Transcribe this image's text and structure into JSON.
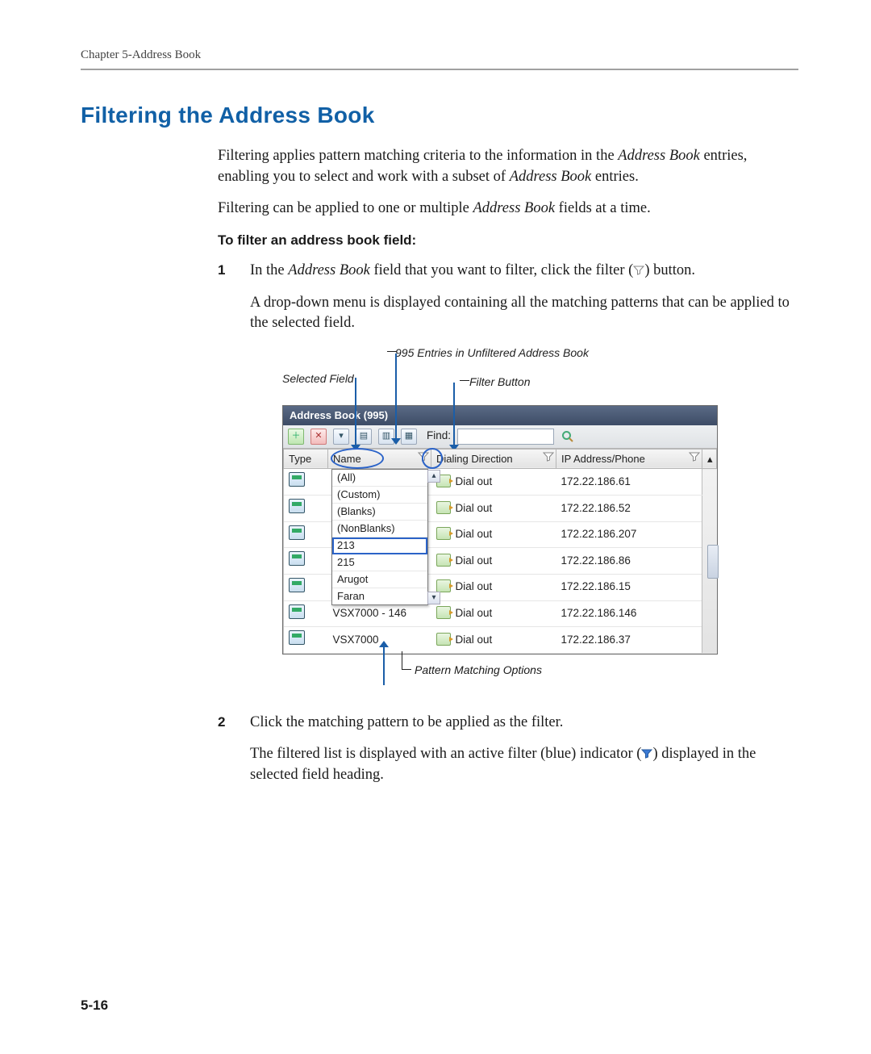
{
  "header": {
    "running_head": "Chapter 5-Address Book"
  },
  "title": "Filtering the Address Book",
  "intro": {
    "p1a": "Filtering applies pattern matching criteria to the information in the ",
    "p1b": "Address Book",
    "p1c": " entries, enabling you to select and work with a subset of ",
    "p1d": "Address Book",
    "p1e": " entries.",
    "p2a": "Filtering can be applied to one or multiple ",
    "p2b": "Address Book",
    "p2c": " fields at a time."
  },
  "lead": "To filter an address book field:",
  "steps": {
    "s1": {
      "num": "1",
      "t1a": "In the ",
      "t1b": "Address Book",
      "t1c": " field that you want to filter, click the filter (",
      "t1d": ") button.",
      "t2": "A drop-down menu is displayed containing all the matching patterns that can be applied to the selected field."
    },
    "s2": {
      "num": "2",
      "t1": "Click the matching pattern to be applied as the filter.",
      "t2a": "The filtered list is displayed with an active filter (blue) indicator (",
      "t2b": ") displayed in the selected field heading."
    }
  },
  "callouts": {
    "entries": "995 Entries in Unfiltered Address Book",
    "selected_field": "Selected Field",
    "filter_button": "Filter Button",
    "pattern_options": "Pattern Matching Options"
  },
  "shot": {
    "title": "Address Book (995)",
    "find_label": "Find:",
    "find_value": "",
    "columns": {
      "type": "Type",
      "name": "Name",
      "direction": "Dialing Direction",
      "ip": "IP Address/Phone"
    },
    "dropdown_options": [
      "(All)",
      "(Custom)",
      "(Blanks)",
      "(NonBlanks)",
      "213",
      "215",
      "Arugot",
      "Faran"
    ],
    "dropdown_highlight_index": 4,
    "rows": [
      {
        "name": "",
        "direction": "Dial out",
        "ip": "172.22.186.61"
      },
      {
        "name": "",
        "direction": "Dial out",
        "ip": "172.22.186.52"
      },
      {
        "name": "",
        "direction": "Dial out",
        "ip": "172.22.186.207"
      },
      {
        "name": "",
        "direction": "Dial out",
        "ip": "172.22.186.86"
      },
      {
        "name": "",
        "direction": "Dial out",
        "ip": "172.22.186.15"
      },
      {
        "name": "VSX7000 - 146",
        "direction": "Dial out",
        "ip": "172.22.186.146"
      },
      {
        "name": "VSX7000",
        "direction": "Dial out",
        "ip": "172.22.186.37"
      }
    ]
  },
  "page_number": "5-16",
  "icons": {
    "funnel_gray_svg": "<svg viewBox='0 0 14 14' width='14' height='14'><path d='M1 2 h12 l-4.5 5 v4 l-3 1 v-5 Z' fill='#fff' stroke='#888' stroke-width='1'/></svg>",
    "funnel_blue_svg": "<svg viewBox='0 0 14 14' width='14' height='14'><path d='M1 2 h12 l-4.5 5 v4 l-3 1 v-5 Z' fill='#3b7bd6' stroke='#255a9e' stroke-width='1'/></svg>",
    "magnifier_svg": "<svg viewBox='0 0 16 16' width='16' height='16'><circle cx='6.5' cy='6.5' r='4.5' fill='none' stroke='#4a7' stroke-width='2'/><line x1='10' y1='10' x2='14' y2='14' stroke='#b88a3a' stroke-width='2'/></svg>"
  }
}
